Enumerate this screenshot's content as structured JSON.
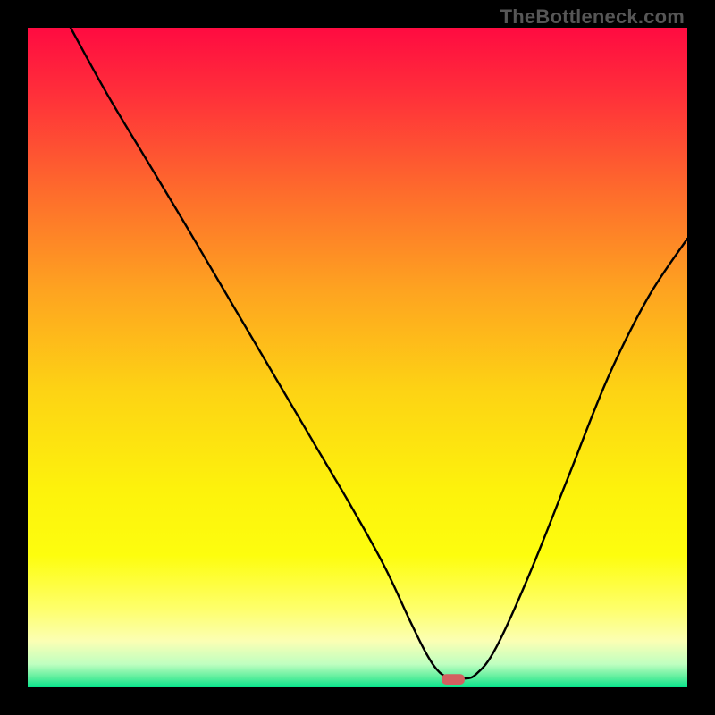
{
  "watermark": "TheBottleneck.com",
  "chart_data": {
    "type": "line",
    "title": "",
    "xlabel": "",
    "ylabel": "",
    "xlim": [
      0,
      100
    ],
    "ylim": [
      0,
      100
    ],
    "grid": false,
    "gradient_stops": [
      {
        "offset": 0.0,
        "color": "#ff0b41"
      },
      {
        "offset": 0.1,
        "color": "#ff2f3a"
      },
      {
        "offset": 0.25,
        "color": "#fe6c2c"
      },
      {
        "offset": 0.4,
        "color": "#fea420"
      },
      {
        "offset": 0.55,
        "color": "#fdd314"
      },
      {
        "offset": 0.7,
        "color": "#fdf20c"
      },
      {
        "offset": 0.8,
        "color": "#fdfd0e"
      },
      {
        "offset": 0.88,
        "color": "#feff6a"
      },
      {
        "offset": 0.93,
        "color": "#fbffb4"
      },
      {
        "offset": 0.965,
        "color": "#bfffc0"
      },
      {
        "offset": 0.985,
        "color": "#5dee9d"
      },
      {
        "offset": 1.0,
        "color": "#06e58d"
      }
    ],
    "series": [
      {
        "name": "bottleneck-curve",
        "color": "#000000",
        "x": [
          6.5,
          12,
          18,
          24,
          29,
          34,
          39,
          44,
          49,
          54,
          58,
          60.5,
          62.5,
          64.5,
          66,
          68,
          71,
          76,
          82,
          88,
          94,
          100
        ],
        "y": [
          100,
          90,
          80,
          70,
          61.5,
          53,
          44.5,
          36,
          27.5,
          18.5,
          10,
          5,
          2.2,
          1.3,
          1.3,
          2,
          6,
          17,
          32,
          47,
          59,
          68
        ],
        "note": "V-shaped curve descending from upper-left, flattening near bottom around x≈63–66, then rising toward the right. y values approximate percent height read from the unlabeled plot."
      }
    ],
    "marker": {
      "name": "optimal-point",
      "shape": "rounded-rect",
      "color": "#d36060",
      "x": 64.5,
      "y": 1.2,
      "width_pct": 3.5,
      "height_pct": 1.6
    }
  }
}
